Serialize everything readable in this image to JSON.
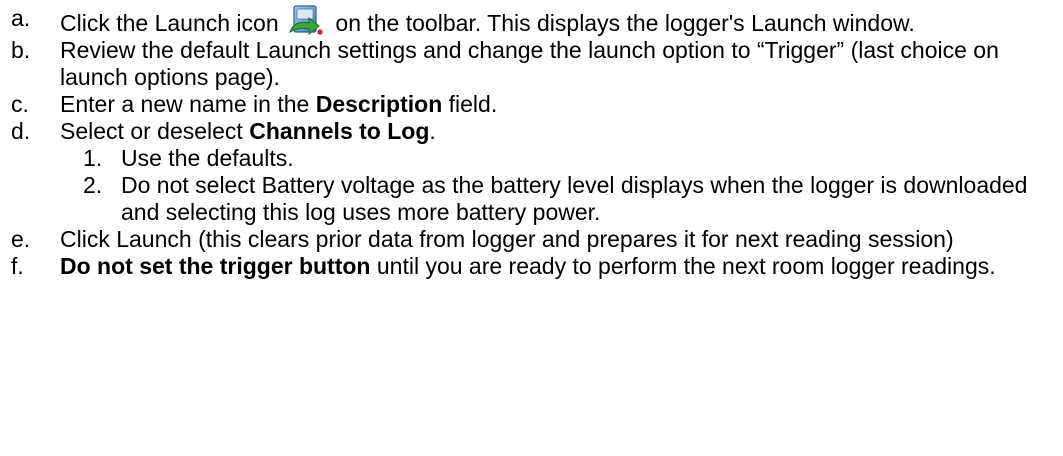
{
  "colors": {
    "text": "#000000",
    "background": "#ffffff",
    "icon_page": "#3f7fc0",
    "icon_arrow": "#3fa33f",
    "icon_dot": "#d42020"
  },
  "icons": {
    "launch": "launch-icon"
  },
  "steps": [
    {
      "marker": "a.",
      "pre": "Click the Launch icon",
      "post": "on the toolbar. This displays the logger's Launch window."
    },
    {
      "marker": "b.",
      "text": "Review the default Launch settings and change the launch option to “Trigger” (last choice on launch options page)."
    },
    {
      "marker": "c.",
      "pre": "Enter a new name in the",
      "bold": "Description",
      "post": "field."
    },
    {
      "marker": "d.",
      "pre": "Select or deselect",
      "bold": "Channels to Log",
      "post": ".",
      "sub": [
        {
          "marker": "1.",
          "text": "Use the defaults."
        },
        {
          "marker": "2.",
          "text": "Do not select Battery voltage as the battery level displays when the logger is downloaded and selecting this log uses more battery power."
        }
      ]
    },
    {
      "marker": "e.",
      "text": "Click Launch (this clears prior data from logger and prepares it for next reading session)"
    },
    {
      "marker": "f.",
      "bold": "Do not set the trigger button",
      "post": "until you are ready to perform the next room logger readings."
    }
  ]
}
